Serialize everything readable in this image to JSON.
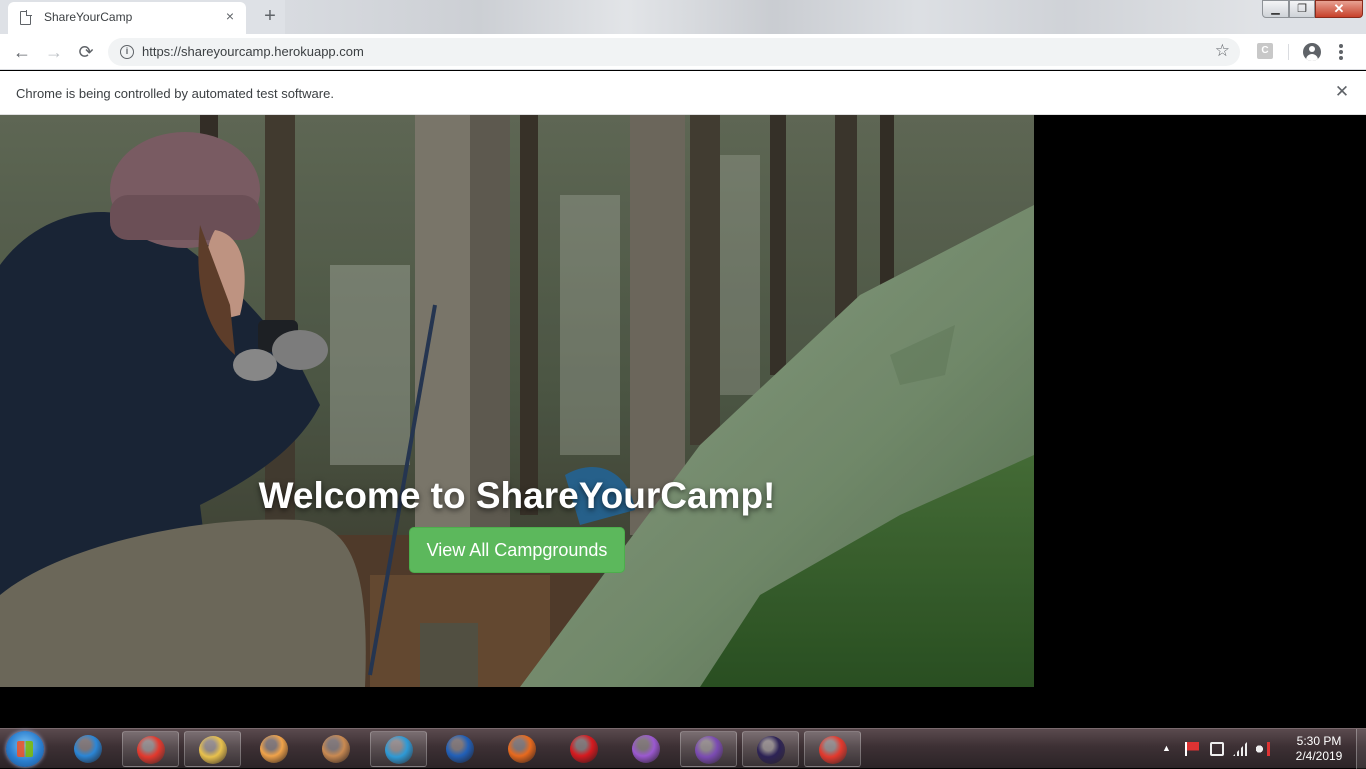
{
  "browser": {
    "tab_title": "ShareYourCamp",
    "tab_close": "×",
    "new_tab": "+",
    "url": "https://shareyourcamp.herokuapp.com",
    "nav_back": "←",
    "nav_forward": "→",
    "nav_reload": "⟳",
    "bookmark_star": "☆",
    "extension_label": "C",
    "window_min": "▁",
    "window_max": "❐",
    "window_close": "✕"
  },
  "infobar": {
    "message": "Chrome is being controlled by automated test software.",
    "close": "✕"
  },
  "page": {
    "hero_title": "Welcome to ShareYourCamp!",
    "hero_button": "View All Campgrounds",
    "accent_color": "#5cb85c"
  },
  "taskbar": {
    "apps": [
      {
        "name": "internet-explorer-icon",
        "color": "#2b86d6",
        "pinned": false
      },
      {
        "name": "chrome-icon",
        "color": "#e3392d",
        "pinned": true
      },
      {
        "name": "file-explorer-icon",
        "color": "#e8c14d",
        "pinned": true
      },
      {
        "name": "media-player-icon",
        "color": "#f0a34a",
        "pinned": false
      },
      {
        "name": "remote-desktop-icon",
        "color": "#c98a52",
        "pinned": false
      },
      {
        "name": "hp-icon",
        "color": "#2e9ad6",
        "pinned": true
      },
      {
        "name": "thunderbird-icon",
        "color": "#2160b8",
        "pinned": false
      },
      {
        "name": "firefox-icon",
        "color": "#e86a1e",
        "pinned": false
      },
      {
        "name": "opera-icon",
        "color": "#d61a1f",
        "pinned": false
      },
      {
        "name": "swirl-app-icon",
        "color": "#9b59d0",
        "pinned": false
      },
      {
        "name": "visual-studio-icon",
        "color": "#7b4bb3",
        "pinned": true
      },
      {
        "name": "eclipse-icon",
        "color": "#2c2255",
        "pinned": true
      },
      {
        "name": "chrome-active-icon",
        "color": "#e3392d",
        "pinned": true
      }
    ],
    "clock_time": "5:30 PM",
    "clock_date": "2/4/2019",
    "tray_arrow": "▲"
  }
}
